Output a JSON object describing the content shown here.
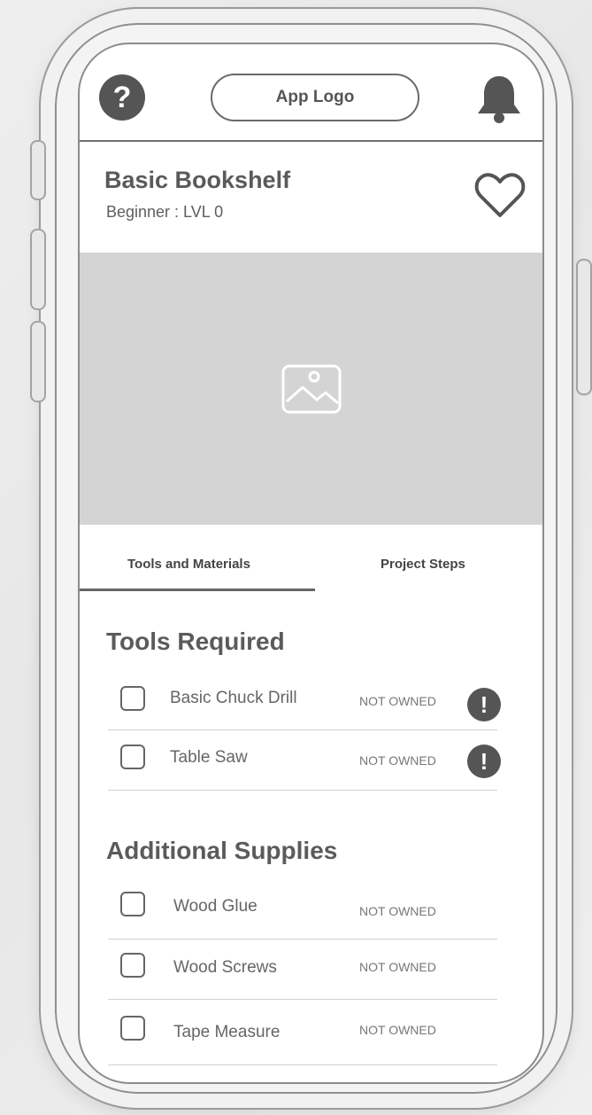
{
  "header": {
    "help_icon": "question-icon",
    "app_logo": "App Logo",
    "notifications_icon": "bell-icon"
  },
  "project": {
    "title": "Basic Bookshelf",
    "level": "Beginner : LVL 0",
    "favorite_icon": "heart-icon",
    "image_icon": "image-placeholder-icon"
  },
  "tabs": [
    {
      "label": "Tools and Materials",
      "active": true
    },
    {
      "label": "Project Steps",
      "active": false
    }
  ],
  "tools_required": {
    "heading": "Tools Required",
    "items": [
      {
        "name": "Basic Chuck Drill",
        "status": "NOT OWNED",
        "warning": "!"
      },
      {
        "name": "Table Saw",
        "status": "NOT OWNED",
        "warning": "!"
      }
    ]
  },
  "additional_supplies": {
    "heading": "Additional Supplies",
    "items": [
      {
        "name": "Wood Glue",
        "status": "NOT OWNED"
      },
      {
        "name": "Wood Screws",
        "status": "NOT OWNED"
      },
      {
        "name": "Tape Measure",
        "status": "NOT OWNED"
      }
    ]
  },
  "colors": {
    "icon_fill": "#555555",
    "image_placeholder": "#d4d4d4",
    "text": "#5a5a5a"
  }
}
